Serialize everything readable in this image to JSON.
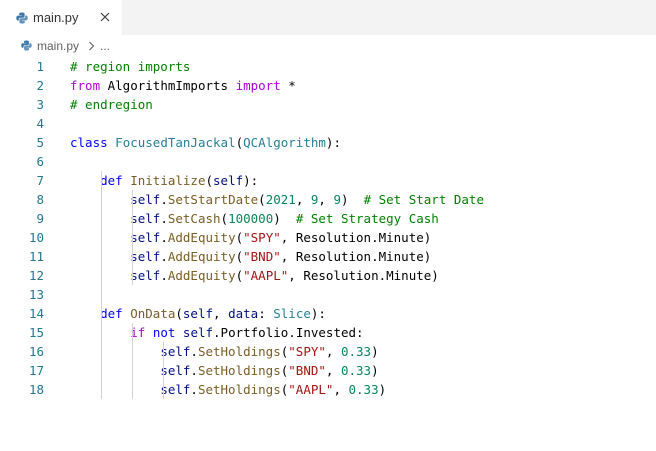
{
  "colors": {
    "comment": "#008000",
    "keyword": "#0000ff",
    "flow_keyword": "#af00db",
    "function": "#795e26",
    "type": "#267f99",
    "string": "#a31515",
    "number": "#098658",
    "parameter": "#001080",
    "text": "#000000",
    "line_number": "#237893",
    "python_icon": "#3c78aa"
  },
  "tab": {
    "title": "main.py",
    "icon": "python-file-icon",
    "close_icon": "close-icon"
  },
  "breadcrumb": {
    "file": "main.py",
    "separator_icon": "chevron-right-icon",
    "ellipsis": "..."
  },
  "editor": {
    "lines": [
      {
        "number": "1",
        "tokens": [
          {
            "t": "comment",
            "v": "# region imports"
          }
        ]
      },
      {
        "number": "2",
        "tokens": [
          {
            "t": "flow",
            "v": "from"
          },
          {
            "t": "text",
            "v": " AlgorithmImports "
          },
          {
            "t": "flow",
            "v": "import"
          },
          {
            "t": "text",
            "v": " *"
          }
        ]
      },
      {
        "number": "3",
        "tokens": [
          {
            "t": "comment",
            "v": "# endregion"
          }
        ]
      },
      {
        "number": "4",
        "tokens": []
      },
      {
        "number": "5",
        "tokens": [
          {
            "t": "keyword",
            "v": "class"
          },
          {
            "t": "text",
            "v": " "
          },
          {
            "t": "type",
            "v": "FocusedTanJackal"
          },
          {
            "t": "text",
            "v": "("
          },
          {
            "t": "type",
            "v": "QCAlgorithm"
          },
          {
            "t": "text",
            "v": "):"
          }
        ]
      },
      {
        "number": "6",
        "tokens": []
      },
      {
        "number": "7",
        "tokens": [
          {
            "t": "text",
            "v": "    "
          },
          {
            "t": "keyword",
            "v": "def"
          },
          {
            "t": "text",
            "v": " "
          },
          {
            "t": "func",
            "v": "Initialize"
          },
          {
            "t": "text",
            "v": "("
          },
          {
            "t": "param",
            "v": "self"
          },
          {
            "t": "text",
            "v": "):"
          }
        ]
      },
      {
        "number": "8",
        "tokens": [
          {
            "t": "text",
            "v": "        "
          },
          {
            "t": "param",
            "v": "self"
          },
          {
            "t": "text",
            "v": "."
          },
          {
            "t": "func",
            "v": "SetStartDate"
          },
          {
            "t": "text",
            "v": "("
          },
          {
            "t": "number",
            "v": "2021"
          },
          {
            "t": "text",
            "v": ", "
          },
          {
            "t": "number",
            "v": "9"
          },
          {
            "t": "text",
            "v": ", "
          },
          {
            "t": "number",
            "v": "9"
          },
          {
            "t": "text",
            "v": ")  "
          },
          {
            "t": "comment",
            "v": "# Set Start Date"
          }
        ]
      },
      {
        "number": "9",
        "tokens": [
          {
            "t": "text",
            "v": "        "
          },
          {
            "t": "param",
            "v": "self"
          },
          {
            "t": "text",
            "v": "."
          },
          {
            "t": "func",
            "v": "SetCash"
          },
          {
            "t": "text",
            "v": "("
          },
          {
            "t": "number",
            "v": "100000"
          },
          {
            "t": "text",
            "v": ")  "
          },
          {
            "t": "comment",
            "v": "# Set Strategy Cash"
          }
        ]
      },
      {
        "number": "10",
        "tokens": [
          {
            "t": "text",
            "v": "        "
          },
          {
            "t": "param",
            "v": "self"
          },
          {
            "t": "text",
            "v": "."
          },
          {
            "t": "func",
            "v": "AddEquity"
          },
          {
            "t": "text",
            "v": "("
          },
          {
            "t": "string",
            "v": "\"SPY\""
          },
          {
            "t": "text",
            "v": ", Resolution.Minute)"
          }
        ]
      },
      {
        "number": "11",
        "tokens": [
          {
            "t": "text",
            "v": "        "
          },
          {
            "t": "param",
            "v": "self"
          },
          {
            "t": "text",
            "v": "."
          },
          {
            "t": "func",
            "v": "AddEquity"
          },
          {
            "t": "text",
            "v": "("
          },
          {
            "t": "string",
            "v": "\"BND\""
          },
          {
            "t": "text",
            "v": ", Resolution.Minute)"
          }
        ]
      },
      {
        "number": "12",
        "tokens": [
          {
            "t": "text",
            "v": "        "
          },
          {
            "t": "param",
            "v": "self"
          },
          {
            "t": "text",
            "v": "."
          },
          {
            "t": "func",
            "v": "AddEquity"
          },
          {
            "t": "text",
            "v": "("
          },
          {
            "t": "string",
            "v": "\"AAPL\""
          },
          {
            "t": "text",
            "v": ", Resolution.Minute)"
          }
        ]
      },
      {
        "number": "13",
        "tokens": []
      },
      {
        "number": "14",
        "tokens": [
          {
            "t": "text",
            "v": "    "
          },
          {
            "t": "keyword",
            "v": "def"
          },
          {
            "t": "text",
            "v": " "
          },
          {
            "t": "func",
            "v": "OnData"
          },
          {
            "t": "text",
            "v": "("
          },
          {
            "t": "param",
            "v": "self"
          },
          {
            "t": "text",
            "v": ", "
          },
          {
            "t": "param",
            "v": "data"
          },
          {
            "t": "text",
            "v": ": "
          },
          {
            "t": "type",
            "v": "Slice"
          },
          {
            "t": "text",
            "v": "):"
          }
        ]
      },
      {
        "number": "15",
        "tokens": [
          {
            "t": "text",
            "v": "        "
          },
          {
            "t": "flow",
            "v": "if"
          },
          {
            "t": "text",
            "v": " "
          },
          {
            "t": "keyword",
            "v": "not"
          },
          {
            "t": "text",
            "v": " "
          },
          {
            "t": "param",
            "v": "self"
          },
          {
            "t": "text",
            "v": ".Portfolio.Invested:"
          }
        ]
      },
      {
        "number": "16",
        "tokens": [
          {
            "t": "text",
            "v": "            "
          },
          {
            "t": "param",
            "v": "self"
          },
          {
            "t": "text",
            "v": "."
          },
          {
            "t": "func",
            "v": "SetHoldings"
          },
          {
            "t": "text",
            "v": "("
          },
          {
            "t": "string",
            "v": "\"SPY\""
          },
          {
            "t": "text",
            "v": ", "
          },
          {
            "t": "number",
            "v": "0.33"
          },
          {
            "t": "text",
            "v": ")"
          }
        ]
      },
      {
        "number": "17",
        "tokens": [
          {
            "t": "text",
            "v": "            "
          },
          {
            "t": "param",
            "v": "self"
          },
          {
            "t": "text",
            "v": "."
          },
          {
            "t": "func",
            "v": "SetHoldings"
          },
          {
            "t": "text",
            "v": "("
          },
          {
            "t": "string",
            "v": "\"BND\""
          },
          {
            "t": "text",
            "v": ", "
          },
          {
            "t": "number",
            "v": "0.33"
          },
          {
            "t": "text",
            "v": ")"
          }
        ]
      },
      {
        "number": "18",
        "tokens": [
          {
            "t": "text",
            "v": "            "
          },
          {
            "t": "param",
            "v": "self"
          },
          {
            "t": "text",
            "v": "."
          },
          {
            "t": "func",
            "v": "SetHoldings"
          },
          {
            "t": "text",
            "v": "("
          },
          {
            "t": "string",
            "v": "\"AAPL\""
          },
          {
            "t": "text",
            "v": ", "
          },
          {
            "t": "number",
            "v": "0.33"
          },
          {
            "t": "text",
            "v": ")"
          }
        ]
      }
    ]
  }
}
